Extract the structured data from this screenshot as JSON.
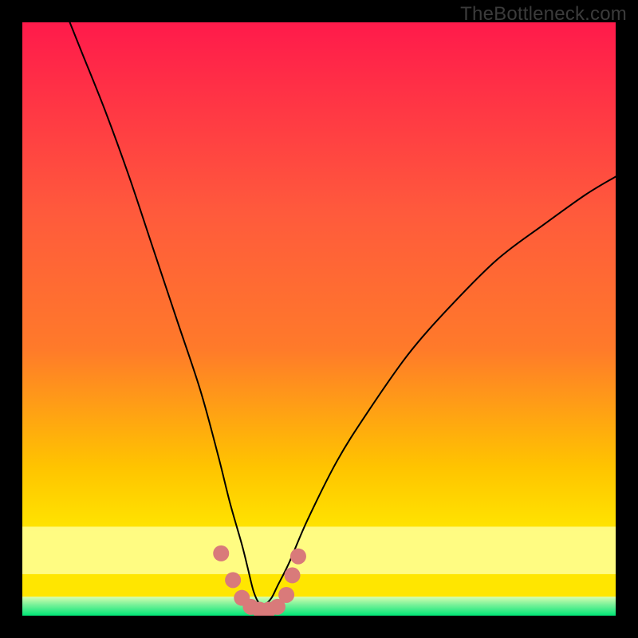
{
  "watermark": "TheBottleneck.com",
  "chart_data": {
    "type": "line",
    "title": "",
    "xlabel": "",
    "ylabel": "",
    "xlim": [
      0,
      100
    ],
    "ylim": [
      0,
      100
    ],
    "background_gradient": {
      "top": "#ff1a4b",
      "mid1": "#ff7a2a",
      "mid2": "#ffe600",
      "band": "#ffff99",
      "bottom": "#00e676"
    },
    "curve": {
      "description": "V-shaped bottleneck curve; near-vertical descent from upper-left, dip to near-zero around x≈40, gentle rise to upper-right",
      "x": [
        8,
        10,
        14,
        18,
        22,
        26,
        30,
        33,
        35,
        37,
        38,
        39,
        40,
        41,
        42,
        43,
        45,
        48,
        53,
        58,
        65,
        72,
        80,
        88,
        95,
        100
      ],
      "y": [
        100,
        95,
        85,
        74,
        62,
        50,
        38,
        27,
        19,
        12,
        8,
        4,
        2,
        2,
        3,
        5,
        9,
        16,
        26,
        34,
        44,
        52,
        60,
        66,
        71,
        74
      ]
    },
    "markers": {
      "color": "#d97a7a",
      "radius": 10,
      "points": [
        {
          "x": 33.5,
          "y": 10.5
        },
        {
          "x": 35.5,
          "y": 6.0
        },
        {
          "x": 37.0,
          "y": 3.0
        },
        {
          "x": 38.5,
          "y": 1.5
        },
        {
          "x": 40.0,
          "y": 1.0
        },
        {
          "x": 41.5,
          "y": 1.0
        },
        {
          "x": 43.0,
          "y": 1.5
        },
        {
          "x": 44.5,
          "y": 3.5
        },
        {
          "x": 45.5,
          "y": 6.8
        },
        {
          "x": 46.5,
          "y": 10.0
        }
      ]
    }
  }
}
